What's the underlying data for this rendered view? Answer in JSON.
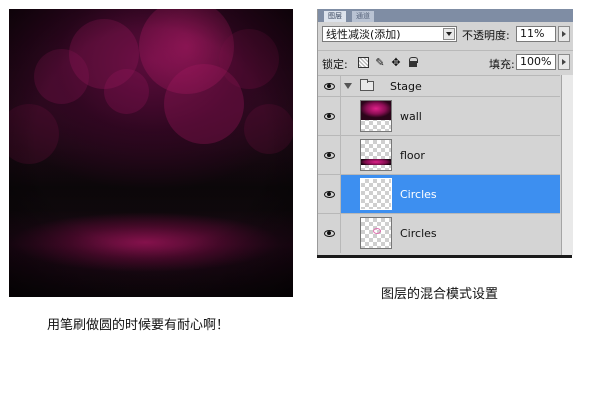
{
  "panel": {
    "tabs": [
      "图层",
      "通道"
    ],
    "blend_mode": "线性减淡(添加)",
    "opacity_label": "不透明度:",
    "opacity_value": "11%",
    "lock_label": "锁定:",
    "fill_label": "填充:",
    "fill_value": "100%",
    "layers": [
      {
        "name": "Stage",
        "type": "group",
        "visible": true
      },
      {
        "name": "wall",
        "type": "layer",
        "visible": true,
        "selected": false
      },
      {
        "name": "floor",
        "type": "layer",
        "visible": true,
        "selected": false
      },
      {
        "name": "Circles",
        "type": "layer",
        "visible": true,
        "selected": true
      },
      {
        "name": "Circles",
        "type": "layer",
        "visible": true,
        "selected": false
      }
    ]
  },
  "captions": {
    "left": "用笔刷做圆的时候要有耐心啊！",
    "right": "图层的混合模式设置"
  },
  "colors": {
    "selection": "#3d8ff0",
    "panel_bg": "#d4d4d4",
    "accent_magenta": "#c0176f"
  }
}
